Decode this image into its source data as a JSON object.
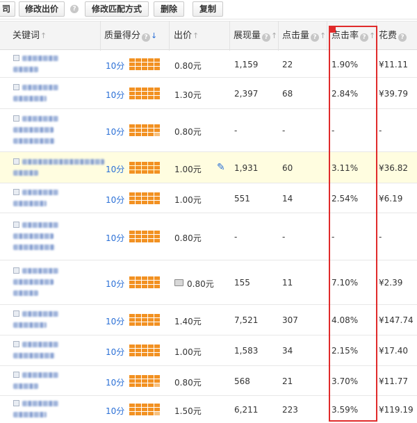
{
  "toolbar": {
    "buttons": [
      "司",
      "修改出价",
      "修改匹配方式",
      "删除",
      "复制"
    ],
    "help": "?"
  },
  "table": {
    "columns": [
      "关键词",
      "质量得分",
      "出价",
      "展现量",
      "点击量",
      "点击率",
      "花费"
    ],
    "help": "?",
    "sort_up": "↑",
    "sort_down": "↓",
    "rows": [
      {
        "score": "10分",
        "bid": "0.80元",
        "impressions": "1,159",
        "clicks": "22",
        "ctr": "1.90%",
        "cost": "¥11.11",
        "quality": 1.0
      },
      {
        "score": "10分",
        "bid": "1.30元",
        "impressions": "2,397",
        "clicks": "68",
        "ctr": "2.84%",
        "cost": "¥39.79",
        "quality": 1.0
      },
      {
        "score": "10分",
        "bid": "0.80元",
        "impressions": "-",
        "clicks": "-",
        "ctr": "-",
        "cost": "-",
        "quality": 0.9
      },
      {
        "score": "10分",
        "bid": "1.00元",
        "impressions": "1,931",
        "clicks": "60",
        "ctr": "3.11%",
        "cost": "¥36.82",
        "quality": 1.0,
        "highlighted": true
      },
      {
        "score": "10分",
        "bid": "1.00元",
        "impressions": "551",
        "clicks": "14",
        "ctr": "2.54%",
        "cost": "¥6.19",
        "quality": 1.0
      },
      {
        "score": "10分",
        "bid": "0.80元",
        "impressions": "-",
        "clicks": "-",
        "ctr": "-",
        "cost": "-",
        "quality": 1.0
      },
      {
        "score": "10分",
        "bid": "0.80元",
        "impressions": "155",
        "clicks": "11",
        "ctr": "7.10%",
        "cost": "¥2.39",
        "quality": 1.0,
        "badge": true
      },
      {
        "score": "10分",
        "bid": "1.40元",
        "impressions": "7,521",
        "clicks": "307",
        "ctr": "4.08%",
        "cost": "¥147.74",
        "quality": 1.0
      },
      {
        "score": "10分",
        "bid": "1.00元",
        "impressions": "1,583",
        "clicks": "34",
        "ctr": "2.15%",
        "cost": "¥17.40",
        "quality": 1.0
      },
      {
        "score": "10分",
        "bid": "0.80元",
        "impressions": "568",
        "clicks": "21",
        "ctr": "3.70%",
        "cost": "¥11.77",
        "quality": 0.9
      },
      {
        "score": "10分",
        "bid": "1.50元",
        "impressions": "6,211",
        "clicks": "223",
        "ctr": "3.59%",
        "cost": "¥119.19",
        "quality": 0.9
      }
    ]
  },
  "colors": {
    "accent": "#2a6fd6",
    "quality_bar": "#f29122",
    "highlight_box": "#e02a2a",
    "row_highlight": "#fffde0"
  }
}
